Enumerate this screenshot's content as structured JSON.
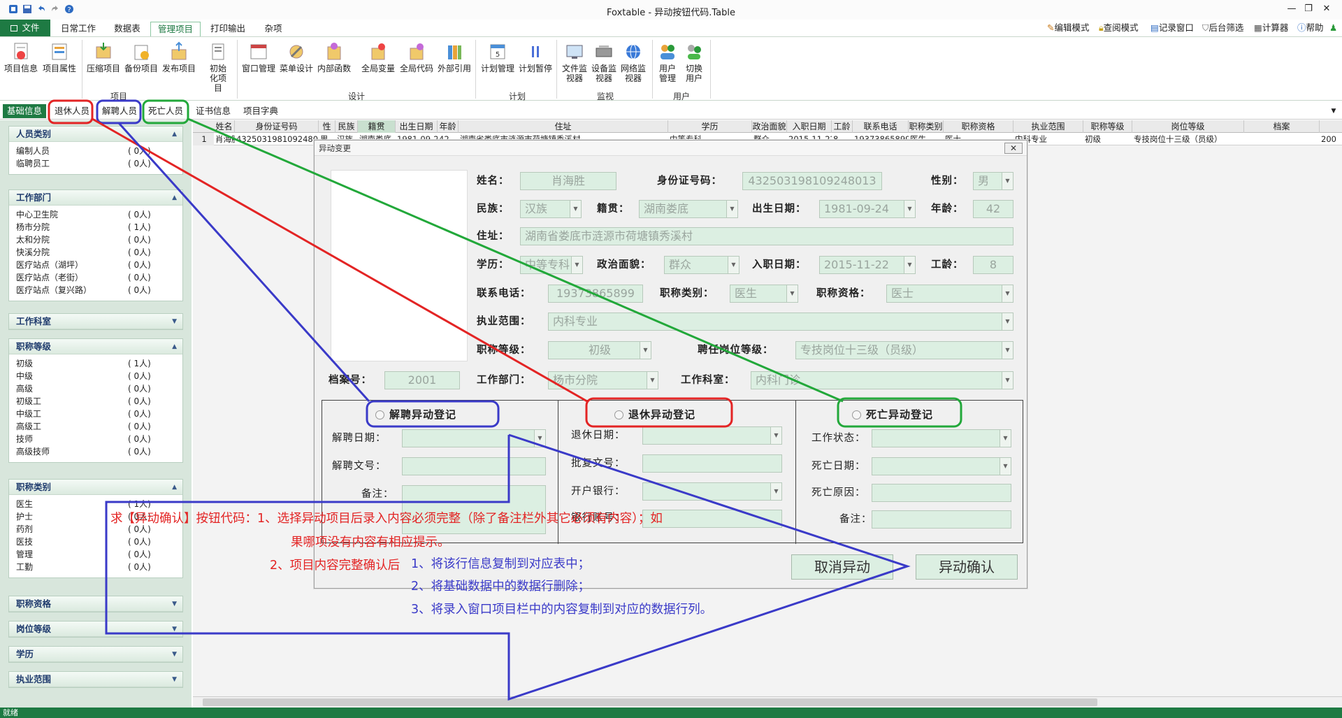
{
  "app": {
    "title": "Foxtable - 异动按钮代码.Table"
  },
  "menu": {
    "file": "文件",
    "tabs": [
      "日常工作",
      "数据表",
      "管理项目",
      "打印输出",
      "杂项"
    ],
    "active_tab": "管理项目",
    "right_tools": [
      "编辑模式",
      "查阅模式",
      "记录窗口",
      "后台筛选",
      "计算器",
      "帮助"
    ]
  },
  "ribbon": {
    "buttons": [
      "项目信息",
      "项目属性",
      "压缩项目",
      "备份项目",
      "发布项目",
      "初始化项目",
      "窗口管理",
      "菜单设计",
      "内部函数",
      "全局变量",
      "全局代码",
      "外部引用",
      "计划管理",
      "计划暂停",
      "文件监视器",
      "设备监视器",
      "网络监视器",
      "用户管理",
      "切换用户"
    ],
    "groups": [
      "项目",
      "设计",
      "计划",
      "监视",
      "用户"
    ]
  },
  "tabs": {
    "items": [
      "基础信息",
      "退休人员",
      "解聘人员",
      "死亡人员",
      "证书信息",
      "项目字典"
    ]
  },
  "sidebar": {
    "sections": [
      {
        "title": "人员类别",
        "items": [
          {
            "label": "编制人员",
            "count": "( 0人)"
          },
          {
            "label": "临聘员工",
            "count": "( 0人)"
          }
        ]
      },
      {
        "title": "工作部门",
        "items": [
          {
            "label": "中心卫生院",
            "count": "( 0人)"
          },
          {
            "label": "杨市分院",
            "count": "( 1人)"
          },
          {
            "label": "太和分院",
            "count": "( 0人)"
          },
          {
            "label": "快溪分院",
            "count": "( 0人)"
          },
          {
            "label": "医疗站点（湖坪）",
            "count": "( 0人)"
          },
          {
            "label": "医疗站点（老街）",
            "count": "( 0人)"
          },
          {
            "label": "医疗站点（复兴路）",
            "count": "( 0人)"
          }
        ]
      },
      {
        "title": "工作科室",
        "items": []
      },
      {
        "title": "职称等级",
        "items": [
          {
            "label": "初级",
            "count": "( 1人)"
          },
          {
            "label": "中级",
            "count": "( 0人)"
          },
          {
            "label": "高级",
            "count": "( 0人)"
          },
          {
            "label": "初级工",
            "count": "( 0人)"
          },
          {
            "label": "中级工",
            "count": "( 0人)"
          },
          {
            "label": "高级工",
            "count": "( 0人)"
          },
          {
            "label": "技师",
            "count": "( 0人)"
          },
          {
            "label": "高级技师",
            "count": "( 0人)"
          }
        ]
      },
      {
        "title": "职称类别",
        "items": [
          {
            "label": "医生",
            "count": "( 1人)"
          },
          {
            "label": "护士",
            "count": "( 0人)"
          },
          {
            "label": "药剂",
            "count": "( 0人)"
          },
          {
            "label": "医技",
            "count": "( 0人)"
          },
          {
            "label": "管理",
            "count": "( 0人)"
          },
          {
            "label": "工勤",
            "count": "( 0人)"
          }
        ]
      },
      {
        "title": "职称资格",
        "items": []
      },
      {
        "title": "岗位等级",
        "items": []
      },
      {
        "title": "学历",
        "items": []
      },
      {
        "title": "执业范围",
        "items": []
      }
    ]
  },
  "grid": {
    "columns": [
      "姓名",
      "身份证号码",
      "性别",
      "民族",
      "籍贯",
      "出生日期",
      "年龄",
      "住址",
      "学历",
      "政治面貌",
      "入职日期",
      "工龄",
      "联系电话",
      "职称类别",
      "职称资格",
      "执业范围",
      "职称等级",
      "岗位等级",
      "档案"
    ],
    "row": {
      "index": "1",
      "name": "肖海胜",
      "id": "4325031981092480...",
      "gender": "男",
      "ethnic": "汉族",
      "origin": "湖南娄底",
      "birth": "1981-09-24",
      "age": "42",
      "address": "湖南省娄底市涟源市荷塘镇秀溪村",
      "edu": "中等专科",
      "politics": "群众",
      "join": "2015-11-22",
      "years": "8",
      "phone": "19373865899",
      "title_type": "医生",
      "title_qual": "医士",
      "scope": "内科专业",
      "level": "初级",
      "post": "专技岗位十三级（员级）",
      "file": "200"
    }
  },
  "dialog": {
    "title": "异动变更",
    "close": "✕",
    "labels": {
      "name": "姓名：",
      "id": "身份证号码：",
      "gender": "性别：",
      "ethnic": "民族：",
      "origin": "籍贯：",
      "birth": "出生日期：",
      "age": "年龄：",
      "address": "住址：",
      "edu": "学历：",
      "politics": "政治面貌：",
      "join": "入职日期：",
      "years": "工龄：",
      "phone": "联系电话：",
      "title_type": "职称类别：",
      "title_qual": "职称资格：",
      "scope": "执业范围：",
      "level": "职称等级：",
      "post": "聘任岗位等级：",
      "file": "档案号：",
      "dept": "工作部门：",
      "office": "工作科室："
    },
    "values": {
      "name": "肖海胜",
      "id": "432503198109248013",
      "gender": "男",
      "ethnic": "汉族",
      "origin": "湖南娄底",
      "birth": "1981-09-24",
      "age": "42",
      "address": "湖南省娄底市涟源市荷塘镇秀溪村",
      "edu": "中等专科",
      "politics": "群众",
      "join": "2015-11-22",
      "years": "8",
      "phone": "19373865899",
      "title_type": "医生",
      "title_qual": "医士",
      "scope": "内科专业",
      "level": "初级",
      "post": "专技岗位十三级（员级）",
      "file": "2001",
      "dept": "杨市分院",
      "office": "内科门诊"
    },
    "dismiss": {
      "radio": "解聘异动登记",
      "labels": [
        "解聘日期：",
        "解聘文号：",
        "备注："
      ]
    },
    "retire": {
      "radio": "退休异动登记",
      "labels": [
        "退休日期：",
        "批复文号：",
        "开户银行：",
        "银行账号："
      ]
    },
    "death": {
      "radio": "死亡异动登记",
      "labels": [
        "工作状态：",
        "死亡日期：",
        "死亡原因：",
        "备注："
      ]
    },
    "cancel": "取消异动",
    "confirm": "异动确认"
  },
  "annotation": {
    "red_line1": "求【异动确认】按钮代码：1、选择异动项目后录入内容必须完整（除了备注栏外其它必须有内容）；如",
    "red_line2": "果哪项没有内容有相应提示。",
    "red_line3": "2、项目内容完整确认后",
    "blue_line1": "1、将该行信息复制到对应表中；",
    "blue_line2": "2、将基础数据中的数据行删除；",
    "blue_line3": "3、将录入窗口项目栏中的内容复制到对应的数据行列。"
  },
  "status": {
    "text": "就绪"
  },
  "colors": {
    "accent": "#1e7a43",
    "annot_red": "#e32424",
    "annot_blue": "#3a3ac8",
    "annot_green": "#22a83a"
  }
}
